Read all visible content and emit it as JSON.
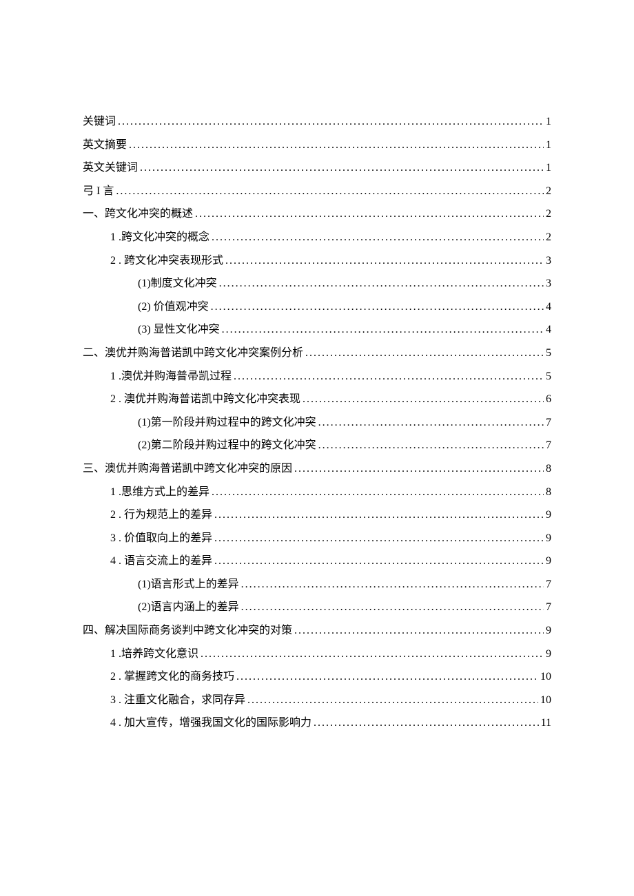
{
  "entries": [
    {
      "level": 0,
      "label": "关键词",
      "page": "1"
    },
    {
      "level": 0,
      "label": "英文摘要",
      "page": "1"
    },
    {
      "level": 0,
      "label": "英文关键词",
      "page": "1"
    },
    {
      "level": 0,
      "label": "弓 I 言",
      "page": "2"
    },
    {
      "level": 0,
      "label": "一、跨文化冲突的概述",
      "page": "2"
    },
    {
      "level": 1,
      "label": "1  .跨文化冲突的概念",
      "page": "2"
    },
    {
      "level": 1,
      "label": "2   . 跨文化冲突表现形式",
      "page": "3"
    },
    {
      "level": 2,
      "label": "(1)制度文化冲突",
      "page": "3"
    },
    {
      "level": 2,
      "label": "(2) 价值观冲突",
      "page": "4"
    },
    {
      "level": 2,
      "label": "(3) 显性文化冲突",
      "page": "4"
    },
    {
      "level": 0,
      "label": "二、澳优并购海普诺凯中跨文化冲突案例分析",
      "page": "5"
    },
    {
      "level": 1,
      "label": "1  .澳优并购海普帚凯过程",
      "page": "5"
    },
    {
      "level": 1,
      "label": "2   . 澳优并购海普诺凯中跨文化冲突表现",
      "page": "6"
    },
    {
      "level": 2,
      "label": "(1)第一阶段并购过程中的跨文化冲突",
      "page": "7"
    },
    {
      "level": 2,
      "label": "(2)第二阶段并购过程中的跨文化冲突",
      "page": "7"
    },
    {
      "level": 0,
      "label": "三、澳优并购海普诺凯中跨文化冲突的原因",
      "page": "8"
    },
    {
      "level": 1,
      "label": "1  .思维方式上的差异",
      "page": "8"
    },
    {
      "level": 1,
      "label": "2   . 行为规范上的差异",
      "page": "9"
    },
    {
      "level": 1,
      "label": "3   . 价值取向上的差异",
      "page": "9"
    },
    {
      "level": 1,
      "label": "4   . 语言交流上的差异",
      "page": "9"
    },
    {
      "level": 2,
      "label": "(1)语言形式上的差异",
      "page": "7"
    },
    {
      "level": 2,
      "label": "(2)语言内涵上的差异",
      "page": "7"
    },
    {
      "level": 0,
      "label": "四、解决国际商务谈判中跨文化冲突的对策",
      "page": "9"
    },
    {
      "level": 1,
      "label": "1  .培养跨文化意识",
      "page": "9"
    },
    {
      "level": 1,
      "label": "2   . 掌握跨文化的商务技巧",
      "page": "10"
    },
    {
      "level": 1,
      "label": "3   . 注重文化融合，求同存异",
      "page": "10"
    },
    {
      "level": 1,
      "label": "4   . 加大宣传，增强我国文化的国际影响力",
      "page": "11"
    }
  ]
}
